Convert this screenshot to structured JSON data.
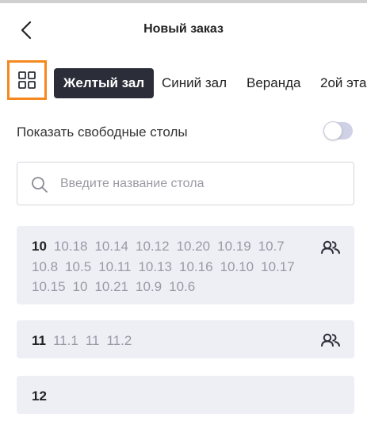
{
  "header": {
    "title": "Новый заказ"
  },
  "tabs": [
    {
      "label": "Желтый зал",
      "active": true
    },
    {
      "label": "Синий зал",
      "active": false
    },
    {
      "label": "Веранда",
      "active": false
    },
    {
      "label": "2ой эта",
      "active": false
    }
  ],
  "toggle": {
    "label": "Показать свободные столы",
    "on": false
  },
  "search": {
    "placeholder": "Введите название стола",
    "value": ""
  },
  "groups": [
    {
      "tables": [
        "10",
        "10.18",
        "10.14",
        "10.12",
        "10.20",
        "10.19",
        "10.7",
        "10.8",
        "10.5",
        "10.11",
        "10.13",
        "10.16",
        "10.10",
        "10.17",
        "10.15",
        "10",
        "10.21",
        "10.9",
        "10.6"
      ],
      "has_people_icon": true
    },
    {
      "tables": [
        "11",
        "11.1",
        "11",
        "11.2"
      ],
      "has_people_icon": true
    },
    {
      "tables": [
        "12"
      ],
      "has_people_icon": false
    }
  ],
  "icons": {
    "back": "chevron-left-icon",
    "grid": "grid-icon",
    "search": "search-icon",
    "people": "people-icon"
  },
  "colors": {
    "active_tab_bg": "#2b2e38",
    "highlight": "#f5891f",
    "card_bg": "#eeeef5",
    "secondary_text": "#999aa6"
  }
}
